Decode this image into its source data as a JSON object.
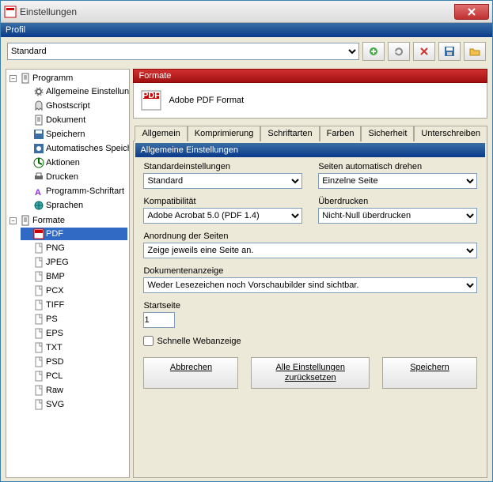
{
  "window": {
    "title": "Einstellungen"
  },
  "profil": {
    "label": "Profil",
    "value": "Standard"
  },
  "toolbar": {
    "add": "add",
    "refresh": "refresh",
    "delete": "delete",
    "save": "save",
    "open": "open"
  },
  "tree": {
    "root1": {
      "label": "Programm",
      "children": [
        {
          "label": "Allgemeine Einstellungen",
          "icon": "gear"
        },
        {
          "label": "Ghostscript",
          "icon": "ghost"
        },
        {
          "label": "Dokument",
          "icon": "doc"
        },
        {
          "label": "Speichern",
          "icon": "save"
        },
        {
          "label": "Automatisches Speichern",
          "icon": "autosave"
        },
        {
          "label": "Aktionen",
          "icon": "action"
        },
        {
          "label": "Drucken",
          "icon": "print"
        },
        {
          "label": "Programm-Schriftart",
          "icon": "font"
        },
        {
          "label": "Sprachen",
          "icon": "lang"
        }
      ]
    },
    "root2": {
      "label": "Formate",
      "children": [
        {
          "label": "PDF",
          "icon": "pdf",
          "selected": true
        },
        {
          "label": "PNG",
          "icon": "file"
        },
        {
          "label": "JPEG",
          "icon": "file"
        },
        {
          "label": "BMP",
          "icon": "file"
        },
        {
          "label": "PCX",
          "icon": "file"
        },
        {
          "label": "TIFF",
          "icon": "file"
        },
        {
          "label": "PS",
          "icon": "file"
        },
        {
          "label": "EPS",
          "icon": "file"
        },
        {
          "label": "TXT",
          "icon": "file"
        },
        {
          "label": "PSD",
          "icon": "file"
        },
        {
          "label": "PCL",
          "icon": "file"
        },
        {
          "label": "Raw",
          "icon": "file"
        },
        {
          "label": "SVG",
          "icon": "file"
        }
      ]
    }
  },
  "formate": {
    "header": "Formate",
    "name": "Adobe PDF Format"
  },
  "tabs": [
    "Allgemein",
    "Komprimierung",
    "Schriftarten",
    "Farben",
    "Sicherheit",
    "Unterschreiben"
  ],
  "panel": {
    "header": "Allgemeine Einstellungen",
    "std": {
      "label": "Standardeinstellungen",
      "value": "Standard"
    },
    "rotate": {
      "label": "Seiten automatisch drehen",
      "value": "Einzelne Seite"
    },
    "compat": {
      "label": "Kompatibilität",
      "value": "Adobe Acrobat 5.0 (PDF 1.4)"
    },
    "overprint": {
      "label": "Überdrucken",
      "value": "Nicht-Null überdrucken"
    },
    "order": {
      "label": "Anordnung der Seiten",
      "value": "Zeige jeweils eine Seite an."
    },
    "docview": {
      "label": "Dokumentenanzeige",
      "value": "Weder Lesezeichen noch Vorschaubilder sind sichtbar."
    },
    "startpage": {
      "label": "Startseite",
      "value": "1"
    },
    "fastweb": {
      "label": "Schnelle Webanzeige",
      "checked": false
    }
  },
  "buttons": {
    "cancel": "Abbrechen",
    "reset": "Alle Einstellungen zurücksetzen",
    "save": "Speichern"
  }
}
